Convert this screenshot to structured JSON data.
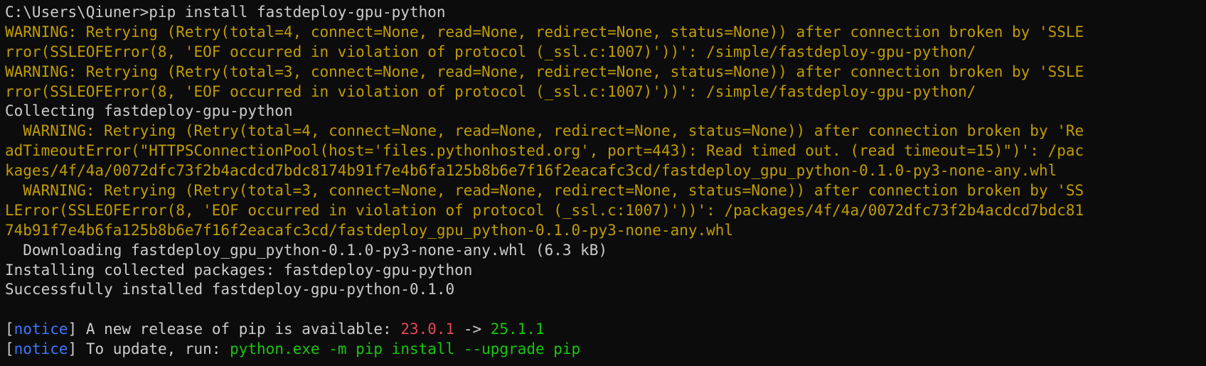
{
  "terminal": {
    "prompt_line": "C:\\Users\\Qiuner>pip install fastdeploy-gpu-python",
    "warnings_top": [
      "WARNING: Retrying (Retry(total=4, connect=None, read=None, redirect=None, status=None)) after connection broken by 'SSLE",
      "rror(SSLEOFError(8, 'EOF occurred in violation of protocol (_ssl.c:1007)'))': /simple/fastdeploy-gpu-python/",
      "WARNING: Retrying (Retry(total=3, connect=None, read=None, redirect=None, status=None)) after connection broken by 'SSLE",
      "rror(SSLEOFError(8, 'EOF occurred in violation of protocol (_ssl.c:1007)'))': /simple/fastdeploy-gpu-python/"
    ],
    "collecting_line": "Collecting fastdeploy-gpu-python",
    "warnings_mid": [
      "  WARNING: Retrying (Retry(total=4, connect=None, read=None, redirect=None, status=None)) after connection broken by 'Re",
      "adTimeoutError(\"HTTPSConnectionPool(host='files.pythonhosted.org', port=443): Read timed out. (read timeout=15)\")': /pac",
      "kages/4f/4a/0072dfc73f2b4acdcd7bdc8174b91f7e4b6fa125b8b6e7f16f2eacafc3cd/fastdeploy_gpu_python-0.1.0-py3-none-any.whl",
      "  WARNING: Retrying (Retry(total=3, connect=None, read=None, redirect=None, status=None)) after connection broken by 'SS",
      "LError(SSLEOFError(8, 'EOF occurred in violation of protocol (_ssl.c:1007)'))': /packages/4f/4a/0072dfc73f2b4acdcd7bdc81",
      "74b91f7e4b6fa125b8b6e7f16f2eacafc3cd/fastdeploy_gpu_python-0.1.0-py3-none-any.whl"
    ],
    "downloading_line": "  Downloading fastdeploy_gpu_python-0.1.0-py3-none-any.whl (6.3 kB)",
    "installing_line": "Installing collected packages: fastdeploy-gpu-python",
    "success_line": "Successfully installed fastdeploy-gpu-python-0.1.0",
    "notice1": {
      "bracket_open": "[",
      "word": "notice",
      "bracket_close": "]",
      "text": " A new release of pip is available: ",
      "old_version": "23.0.1",
      "arrow": " -> ",
      "new_version": "25.1.1"
    },
    "notice2": {
      "bracket_open": "[",
      "word": "notice",
      "bracket_close": "]",
      "text": " To update, run: ",
      "command": "python.exe -m pip install --upgrade pip"
    }
  },
  "colors": {
    "background": "#0c0c0c",
    "foreground": "#cccccc",
    "warning": "#c19c00",
    "notice": "#3b78ff",
    "old_version": "#e74856",
    "new_version": "#16c60c"
  }
}
